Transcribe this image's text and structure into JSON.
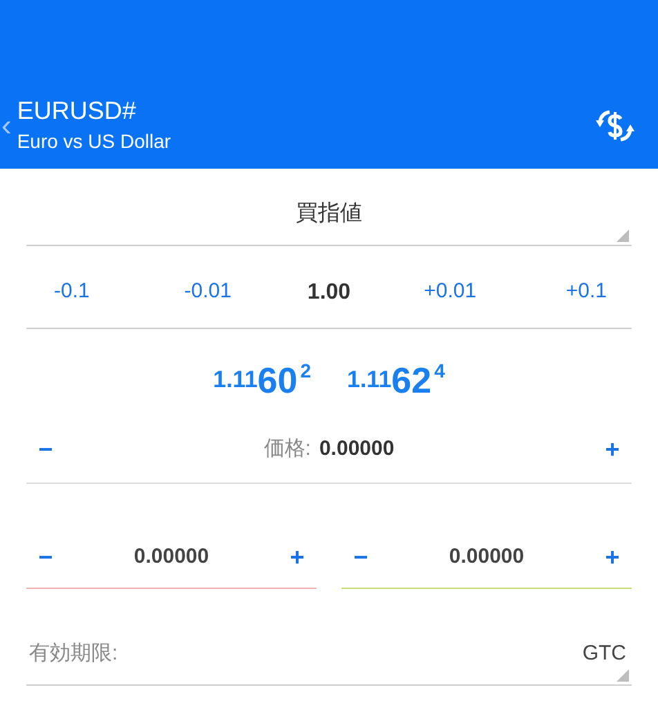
{
  "header": {
    "back": "‹",
    "symbol": "EURUSD#",
    "description": "Euro vs US Dollar"
  },
  "order_type": {
    "value": "買指値"
  },
  "volume": {
    "steps": [
      "-0.1",
      "-0.01",
      "+0.01",
      "+0.1"
    ],
    "value": "1.00"
  },
  "quotes": [
    {
      "small": "1.11",
      "big": "60",
      "sup": "2"
    },
    {
      "small": "1.11",
      "big": "62",
      "sup": "4"
    }
  ],
  "price": {
    "minus": "−",
    "label": "価格:",
    "value": "0.00000",
    "plus": "+"
  },
  "stops": [
    {
      "minus": "−",
      "value": "0.00000",
      "plus": "+",
      "color": "#f0b4b4"
    },
    {
      "minus": "−",
      "value": "0.00000",
      "plus": "+",
      "color": "#c9dc7c"
    }
  ],
  "expiration": {
    "label": "有効期限:",
    "value": "GTC"
  }
}
